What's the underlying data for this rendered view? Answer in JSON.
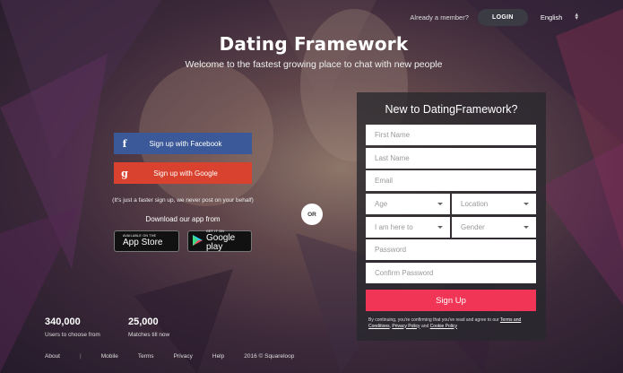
{
  "header": {
    "already_member": "Already a member?",
    "login_label": "LOGIN",
    "language": "English"
  },
  "hero": {
    "brand": "Dating Framework",
    "tagline": "Welcome to the fastest growing place to chat with new people"
  },
  "social": {
    "facebook_label": "Sign up with Facebook",
    "google_label": "Sign up with Google",
    "facebook_icon": "f",
    "google_icon": "g",
    "note": "(It's just a faster sign up, we never post on your behalf)"
  },
  "apps": {
    "download_label": "Download our app from",
    "appstore_small": "AVAILABLE ON THE",
    "appstore_big": "App Store",
    "gplay_small": "GET IT ON",
    "gplay_big": "Google play"
  },
  "divider": {
    "or_label": "OR"
  },
  "form": {
    "title": "New to DatingFramework?",
    "first_name": "First Name",
    "last_name": "Last Name",
    "email": "Email",
    "age": "Age",
    "location": "Location",
    "here_to": "I am here to",
    "gender": "Gender",
    "password": "Password",
    "confirm_password": "Confirm Password",
    "signup_label": "Sign Up",
    "terms_prefix": "By continuing, you're confirming that you've read and agree to our",
    "terms_link": "Terms and Conditions",
    "privacy_link": "Privacy Policy",
    "and_text": "and",
    "cookie_link": "Cookie Policy"
  },
  "stats": [
    {
      "number": "340,000",
      "label": "Users to choose from"
    },
    {
      "number": "25,000",
      "label": "Matches till now"
    }
  ],
  "footer": {
    "about": "About",
    "mobile": "Mobile",
    "terms": "Terms",
    "privacy": "Privacy",
    "help": "Help",
    "copyright": "2016 © Squareloop"
  },
  "colors": {
    "facebook": "#3b5898",
    "google": "#d8422f",
    "signup": "#f03556",
    "panel": "#28282d"
  }
}
